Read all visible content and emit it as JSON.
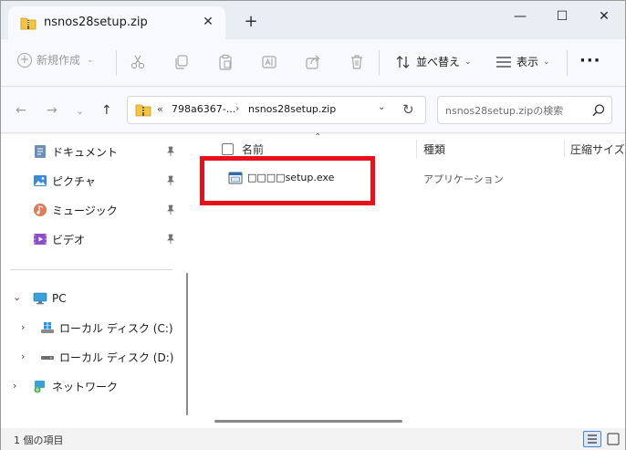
{
  "tab": {
    "title": "nsnos28setup.zip",
    "close_glyph": "✕",
    "new_tab_glyph": "+"
  },
  "window_controls": {
    "minimize": "—",
    "maximize": "☐",
    "close": "✕"
  },
  "command_bar": {
    "new_label": "新規作成",
    "sort_label": "並べ替え",
    "view_label": "表示",
    "more_glyph": "···",
    "icons": [
      "cut-icon",
      "copy-icon",
      "paste-icon",
      "rename-icon",
      "share-icon",
      "delete-icon"
    ]
  },
  "address": {
    "overflow": "«",
    "crumb1": "798a6367-...",
    "separator": "›",
    "crumb2": "nsnos28setup.zip"
  },
  "search": {
    "placeholder": "nsnos28setup.zipの検索"
  },
  "sidebar": {
    "quick_access": [
      {
        "label": "ドキュメント",
        "icon": "documents-icon"
      },
      {
        "label": "ピクチャ",
        "icon": "pictures-icon"
      },
      {
        "label": "ミュージック",
        "icon": "music-icon"
      },
      {
        "label": "ビデオ",
        "icon": "videos-icon"
      }
    ],
    "pc": {
      "label": "PC"
    },
    "drives": [
      {
        "label": "ローカル ディスク (C:)"
      },
      {
        "label": "ローカル ディスク (D:)"
      }
    ],
    "network": {
      "label": "ネットワーク"
    }
  },
  "columns": {
    "name": "名前",
    "type": "種類",
    "size": "圧縮サイズ"
  },
  "files": [
    {
      "name": "□□□□setup.exe",
      "type": "アプリケーション"
    }
  ],
  "status": {
    "item_count": "1 個の項目"
  },
  "colors": {
    "highlight": "#e8101a",
    "accent": "#0067c0"
  }
}
